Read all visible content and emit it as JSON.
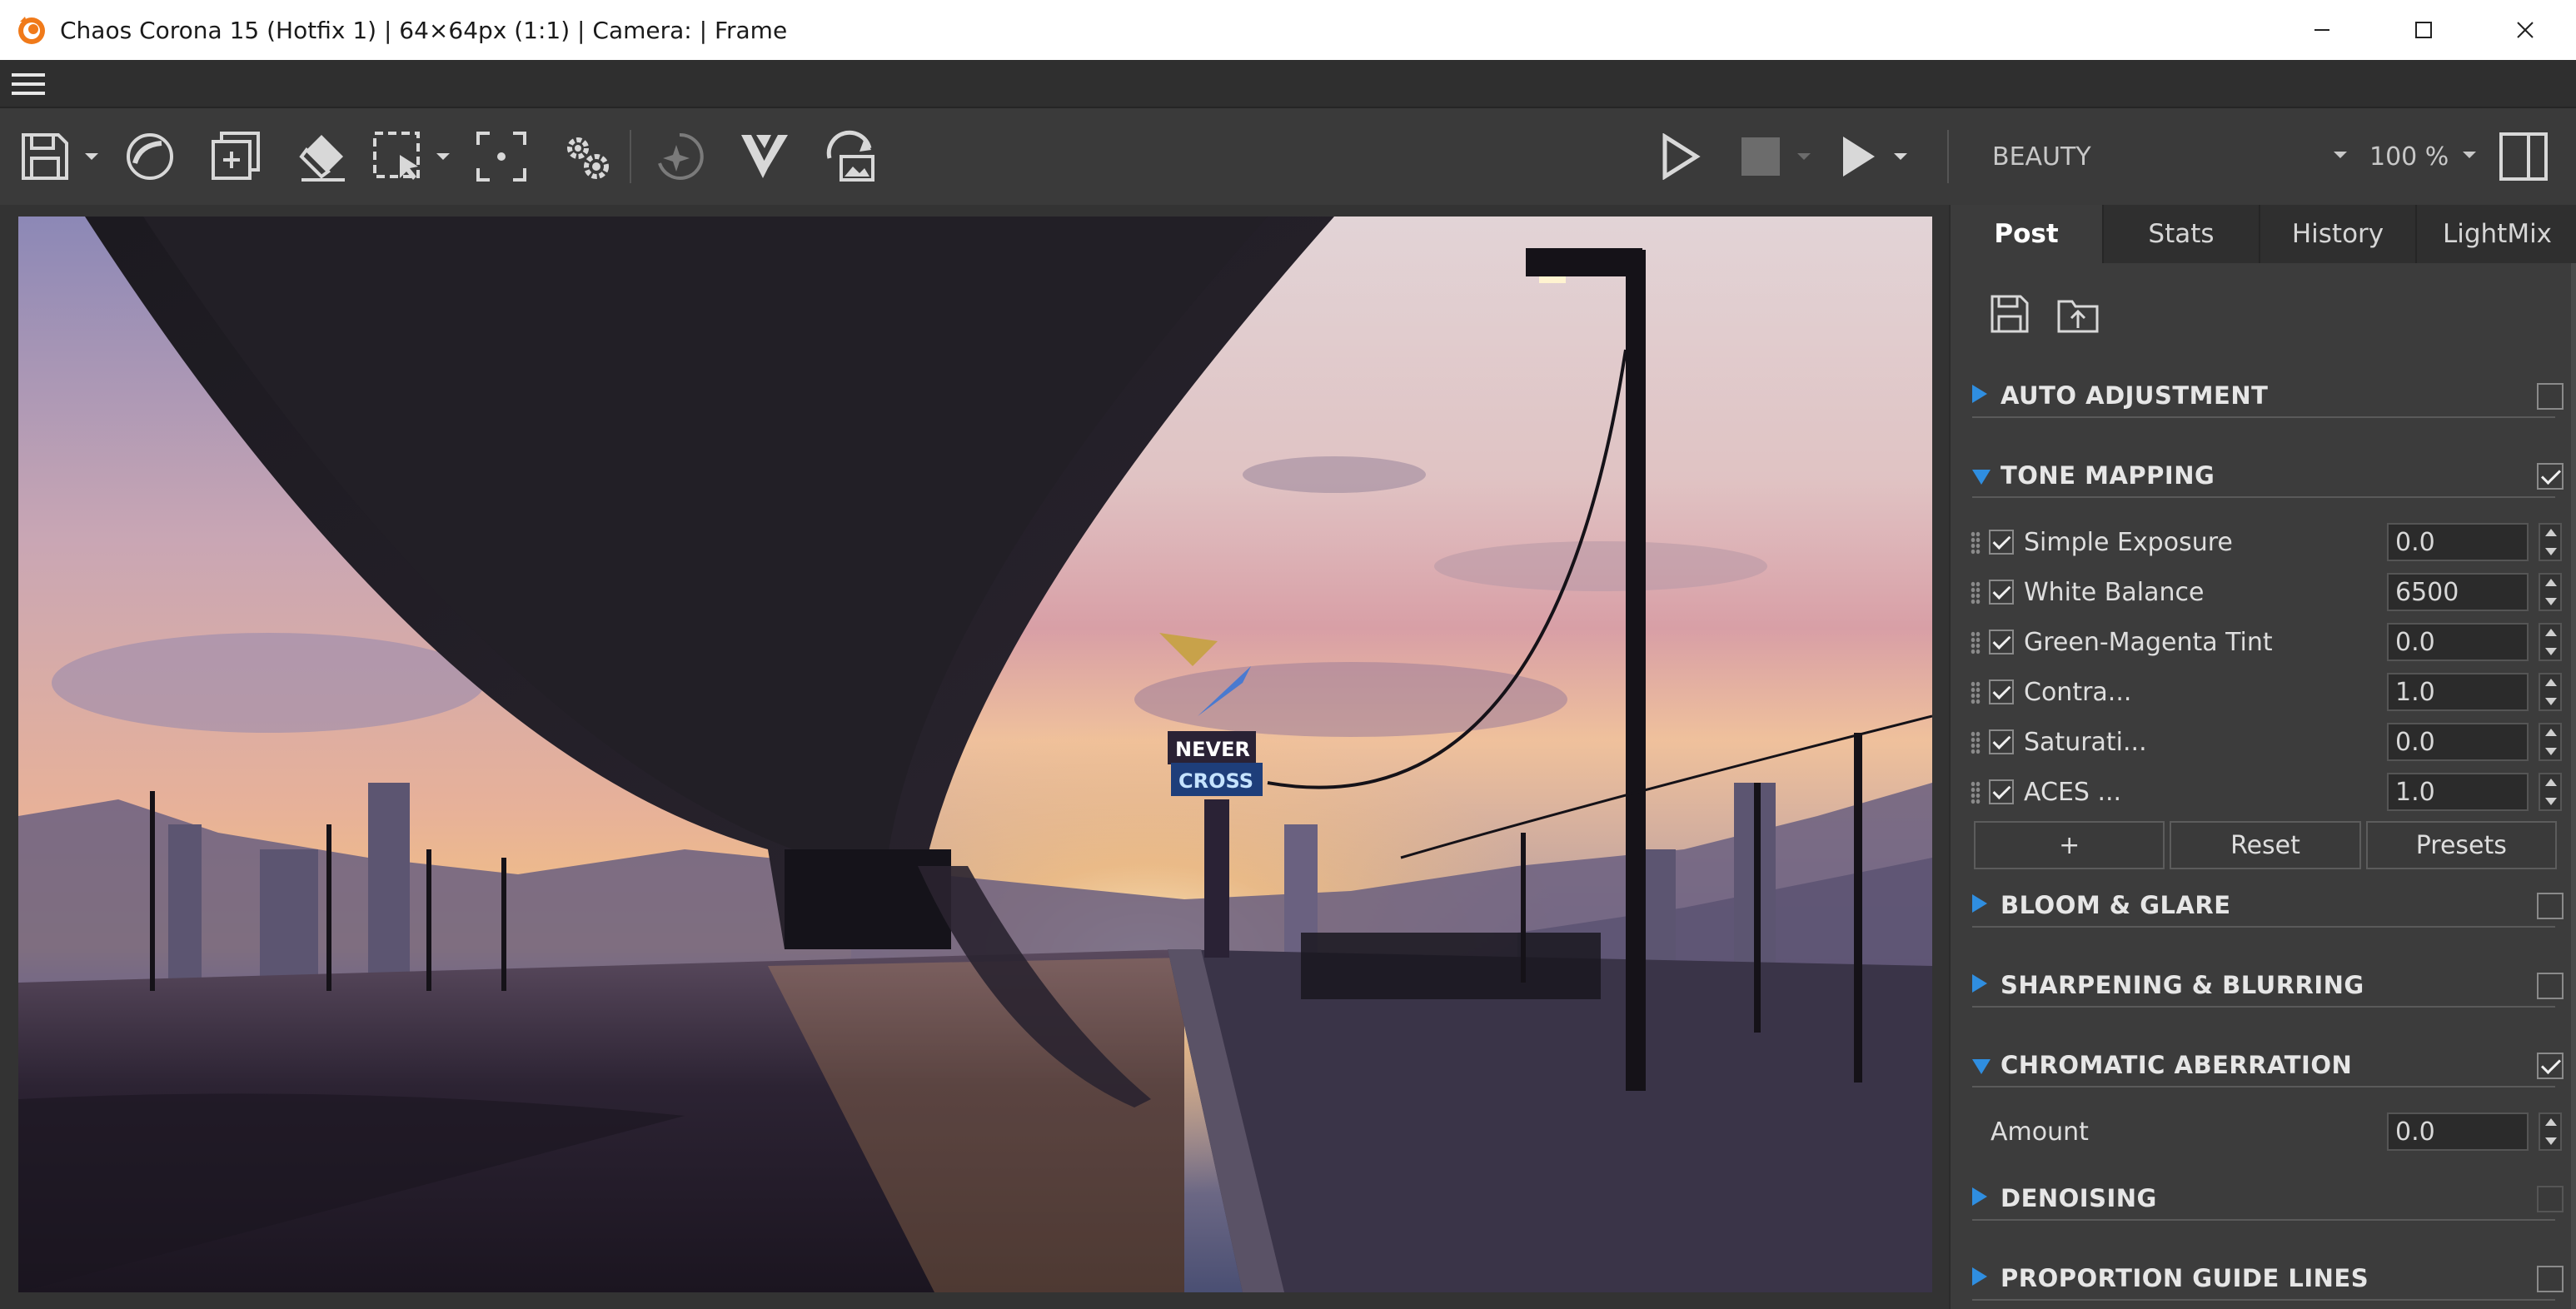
{
  "window": {
    "title": "Chaos Corona 15 (Hotfix 1) | 64×64px (1:1) | Camera:  | Frame",
    "logo_icon": "corona-logo-icon",
    "controls": [
      "minimize-icon",
      "maximize-icon",
      "close-icon"
    ]
  },
  "menu": {
    "icon": "hamburger-menu-icon"
  },
  "toolbar": {
    "icons": [
      "save-icon",
      "save-dropdown-icon",
      "render-sphere-icon",
      "duplicate-icon",
      "eraser-icon",
      "region-select-icon",
      "region-dropdown-icon",
      "focus-region-icon",
      "settings-gear-icon",
      "interactive-render-icon",
      "vantage-icon",
      "render-image-icon",
      "start-render-icon",
      "stop-render-icon",
      "render-play-icon",
      "render-play-dropdown-icon",
      "split-view-icon"
    ],
    "render_pass": "BEAUTY",
    "zoom": "100 %"
  },
  "viewport": {
    "sign_text_1": "NEVER",
    "sign_text_2": "CROSS"
  },
  "panel": {
    "tabs": [
      {
        "label": "Post",
        "active": true
      },
      {
        "label": "Stats",
        "active": false
      },
      {
        "label": "History",
        "active": false
      },
      {
        "label": "LightMix",
        "active": false
      }
    ],
    "icons": [
      "save-preset-icon",
      "load-preset-icon"
    ],
    "sections": {
      "auto_adjustment": {
        "label": "AUTO ADJUSTMENT",
        "expanded": false,
        "enabled": false
      },
      "tone_mapping": {
        "label": "TONE MAPPING",
        "expanded": true,
        "enabled": true
      },
      "bloom_glare": {
        "label": "BLOOM & GLARE",
        "expanded": false,
        "enabled": false
      },
      "sharpening": {
        "label": "SHARPENING & BLURRING",
        "expanded": false,
        "enabled": false
      },
      "chromatic": {
        "label": "CHROMATIC ABERRATION",
        "expanded": true,
        "enabled": true
      },
      "denoising": {
        "label": "DENOISING",
        "expanded": false,
        "enabled": false
      },
      "proportion": {
        "label": "PROPORTION GUIDE LINES",
        "expanded": false,
        "enabled": false
      }
    },
    "tone_ops": [
      {
        "name": "Simple Exposure",
        "value": "0.0",
        "checked": true
      },
      {
        "name": "White Balance",
        "value": "6500",
        "checked": true
      },
      {
        "name": "Green-Magenta Tint",
        "value": "0.0",
        "checked": true
      },
      {
        "name": "Contra...",
        "value": "1.0",
        "checked": true
      },
      {
        "name": "Saturati...",
        "value": "0.0",
        "checked": true
      },
      {
        "name": "ACES ...",
        "value": "1.0",
        "checked": true
      }
    ],
    "buttons": {
      "add": "+",
      "reset": "Reset",
      "presets": "Presets"
    },
    "chromatic_amount": {
      "label": "Amount",
      "value": "0.0"
    }
  }
}
